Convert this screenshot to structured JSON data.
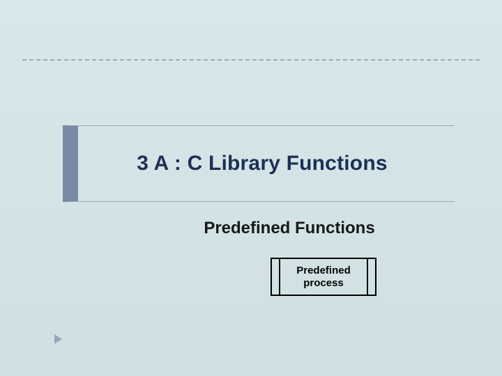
{
  "divider": {
    "present": true
  },
  "title": "3 A : C Library Functions",
  "subtitle": "Predefined Functions",
  "process_box": {
    "line1": "Predefined",
    "line2": "process"
  },
  "colors": {
    "background_top": "#d8e8ea",
    "background_bottom": "#cfe0e2",
    "title_color": "#1e2f56",
    "accent_bar": "#7a8aa6",
    "divider": "#a0a8b0",
    "bullet": "#9aa6b8"
  }
}
